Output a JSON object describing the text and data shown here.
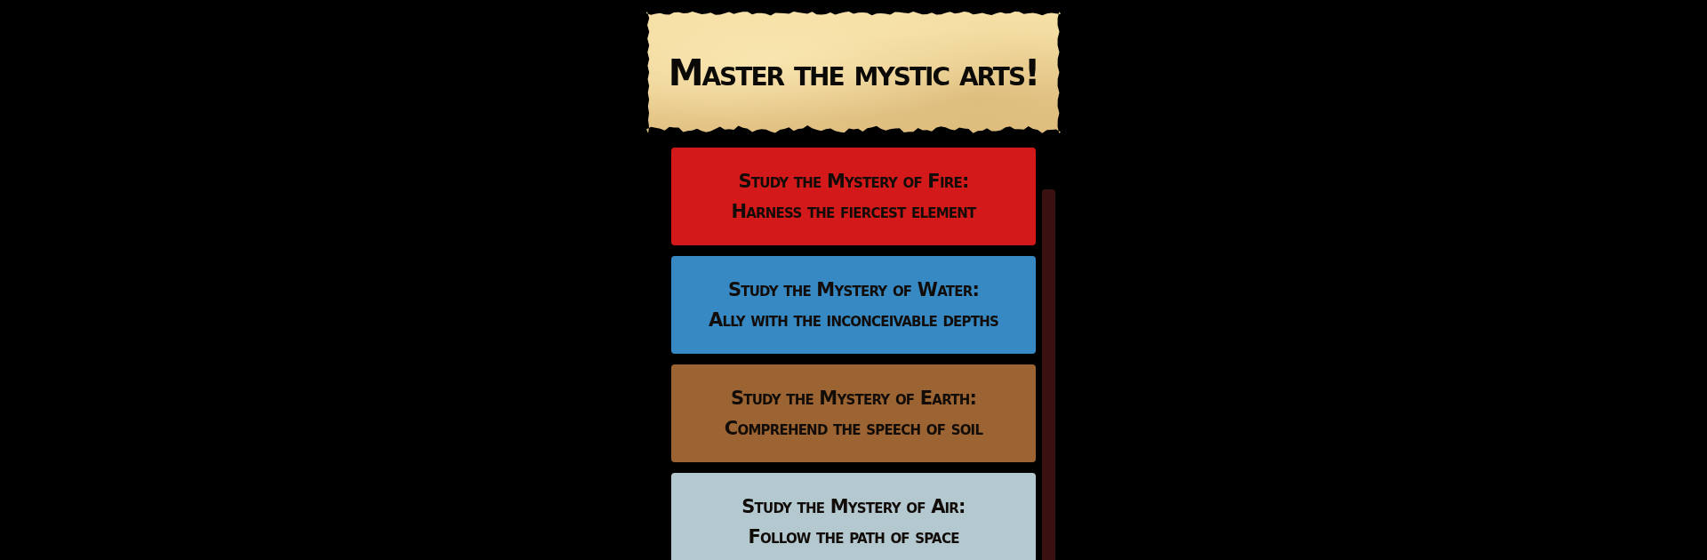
{
  "title": "Master the mystic arts!",
  "mysteries": [
    {
      "heading": "Study the Mystery of Fire:",
      "subtitle": "Harness the fiercest element",
      "color": "#d4191a"
    },
    {
      "heading": "Study the Mystery of Water:",
      "subtitle": "Ally with the inconceivable depths",
      "color": "#3789c3"
    },
    {
      "heading": "Study the Mystery of Earth:",
      "subtitle": "Comprehend the speech of soil",
      "color": "#9c6433"
    },
    {
      "heading": "Study the Mystery of Air:",
      "subtitle": "Follow the path of space",
      "color": "#b3c8cf"
    }
  ]
}
